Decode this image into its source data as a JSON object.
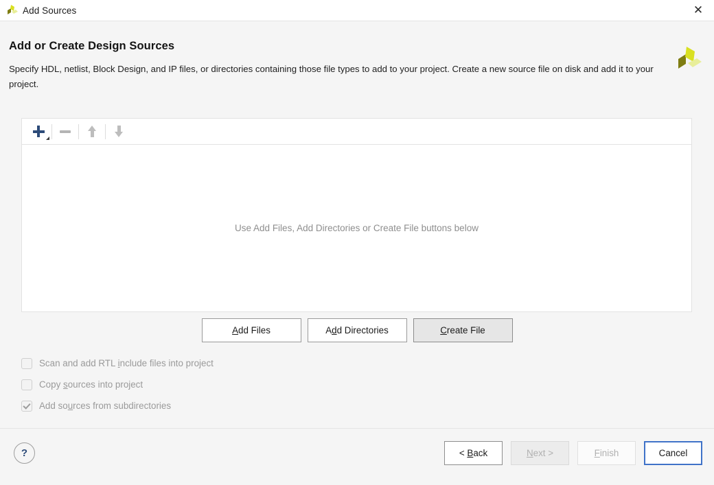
{
  "window": {
    "title": "Add Sources",
    "logo_icon": "vivado-logo-icon",
    "close_icon": "close-icon"
  },
  "content": {
    "heading": "Add or Create Design Sources",
    "description": "Specify HDL, netlist, Block Design, and IP files, or directories containing those file types to add to your project. Create a new source file on disk and add it to your project.",
    "brand_logo_icon": "vivado-brand-logo-icon"
  },
  "list_panel": {
    "toolbar": [
      {
        "name": "add-button",
        "icon": "plus-icon",
        "has_dropdown": true,
        "enabled": true
      },
      {
        "name": "remove-button",
        "icon": "minus-icon",
        "enabled": false
      },
      {
        "name": "move-up-button",
        "icon": "arrow-up-icon",
        "enabled": false
      },
      {
        "name": "move-down-button",
        "icon": "arrow-down-icon",
        "enabled": false
      }
    ],
    "empty_message": "Use Add Files, Add Directories or Create File buttons below"
  },
  "action_buttons": [
    {
      "label_pre": "",
      "mnemonic": "A",
      "label_post": "dd Files",
      "state": "normal"
    },
    {
      "label_pre": "A",
      "mnemonic": "d",
      "label_post": "d Directories",
      "state": "normal"
    },
    {
      "label_pre": "",
      "mnemonic": "C",
      "label_post": "reate File",
      "state": "highlighted"
    }
  ],
  "checkboxes": [
    {
      "label_pre": "Scan and add RTL ",
      "mnemonic": "i",
      "label_post": "nclude files into project",
      "checked": false,
      "enabled": false
    },
    {
      "label_pre": "Copy ",
      "mnemonic": "s",
      "label_post": "ources into project",
      "checked": false,
      "enabled": false
    },
    {
      "label_pre": "Add so",
      "mnemonic": "u",
      "label_post": "rces from subdirectories",
      "checked": true,
      "enabled": false
    }
  ],
  "footer": {
    "help_label": "?",
    "buttons": [
      {
        "label_pre": "< ",
        "mnemonic": "B",
        "label_post": "ack",
        "state": "enabled"
      },
      {
        "label_pre": "",
        "mnemonic": "N",
        "label_post": "ext >",
        "state": "disabled-gray"
      },
      {
        "label_pre": "",
        "mnemonic": "F",
        "label_post": "inish",
        "state": "disabled-white"
      },
      {
        "label_pre": "Cancel",
        "mnemonic": "",
        "label_post": "",
        "state": "focused"
      }
    ]
  },
  "colors": {
    "accent_blue": "#2d4b79",
    "focus_blue": "#3f72c8",
    "logo_olive": "#7f7d12",
    "logo_bright": "#d9e021",
    "logo_pale": "#e8ee9a",
    "background": "#f5f5f5"
  }
}
